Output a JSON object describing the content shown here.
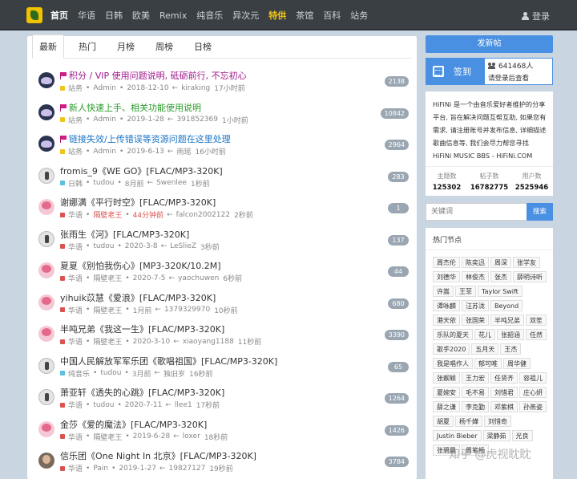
{
  "nav": {
    "items": [
      "首页",
      "华语",
      "日韩",
      "欧美",
      "Remix",
      "纯音乐",
      "异次元",
      "特供",
      "茶馆",
      "百科",
      "站务"
    ],
    "active_index": 0,
    "highlight_index": 7,
    "login": "登录"
  },
  "tabs": [
    "最新",
    "热门",
    "月榜",
    "周榜",
    "日榜"
  ],
  "threads": [
    {
      "icon": "dark-logo-avatar",
      "flag": true,
      "title": "积分 / VIP 使用问题说明, 砥砺前行, 不忘初心",
      "title_color": "#a0178a",
      "tag_color": "#f0c419",
      "forum": "站务",
      "author": "Admin",
      "date": "2018-12-10",
      "reply_user": "kiraking",
      "reply_time": "17小时前",
      "count": "2138"
    },
    {
      "icon": "dark-logo-avatar",
      "flag": true,
      "title": "新人快速上手、相关功能使用说明",
      "title_color": "#2a9a2a",
      "tag_color": "#f0c419",
      "forum": "站务",
      "author": "Admin",
      "date": "2019-1-28",
      "reply_user": "391852369",
      "reply_time": "1小时前",
      "count": "10842"
    },
    {
      "icon": "dark-logo-avatar",
      "flag": true,
      "title": "链接失效/上传错误等资源问题在这里处理",
      "title_color": "#1a74c7",
      "tag_color": "#f0c419",
      "forum": "站务",
      "author": "Admin",
      "date": "2019-6-13",
      "reply_user": "雨瑶",
      "reply_time": "16小时前",
      "count": "2964"
    },
    {
      "icon": "gray-avatar",
      "flag": false,
      "title": "fromis_9《WE GO》[FLAC/MP3-320K]",
      "title_color": "#333",
      "tag_color": "#5bc0de",
      "forum": "日韩",
      "author": "tudou",
      "date": "8月前",
      "reply_user": "Swenlee",
      "reply_time": "1秒前",
      "count": "283"
    },
    {
      "icon": "pink-avatar",
      "flag": false,
      "title": "谢娜满《平行时空》[FLAC/MP3-320K]",
      "title_color": "#333",
      "tag_color": "#d9534f",
      "forum": "华语",
      "author": "隔壁老王",
      "author_red": true,
      "date": "44分钟前",
      "date_red": true,
      "reply_user": "falcon2002122",
      "reply_time": "2秒前",
      "count": "1"
    },
    {
      "icon": "gray-avatar",
      "flag": false,
      "title": "张雨生《河》[FLAC/MP3-320K]",
      "title_color": "#333",
      "tag_color": "#d9534f",
      "forum": "华语",
      "author": "tudou",
      "date": "2020-3-8",
      "reply_user": "LeSlieZ",
      "reply_time": "3秒前",
      "count": "137"
    },
    {
      "icon": "pink-avatar",
      "flag": false,
      "title": "夏夏《别怕我伤心》[MP3-320K/10.2M]",
      "title_color": "#333",
      "tag_color": "#d9534f",
      "forum": "华语",
      "author": "隔壁老王",
      "date": "2020-7-5",
      "reply_user": "yaochuwen",
      "reply_time": "6秒前",
      "count": "44"
    },
    {
      "icon": "pink-avatar",
      "flag": false,
      "title": "yihuik苡慧《爱浪》[FLAC/MP3-320K]",
      "title_color": "#333",
      "tag_color": "#d9534f",
      "forum": "华语",
      "author": "隔壁老王",
      "date": "1月前",
      "reply_user": "1379329970",
      "reply_time": "10秒前",
      "count": "680"
    },
    {
      "icon": "pink-avatar",
      "flag": false,
      "title": "半吨兄弟《我这一生》[FLAC/MP3-320K]",
      "title_color": "#333",
      "tag_color": "#d9534f",
      "forum": "华语",
      "author": "隔壁老王",
      "date": "2020-3-10",
      "reply_user": "xiaoyang1188",
      "reply_time": "11秒前",
      "count": "3390"
    },
    {
      "icon": "gray-avatar",
      "flag": false,
      "title": "中国人民解放军军乐团《歌唱祖国》[FLAC/MP3-320K]",
      "title_color": "#333",
      "tag_color": "#5bc0de",
      "forum": "纯音乐",
      "author": "tudou",
      "date": "3月前",
      "reply_user": "独旧岁",
      "reply_time": "16秒前",
      "count": "65"
    },
    {
      "icon": "gray-avatar",
      "flag": false,
      "title": "萧亚轩《透失的心跳》[FLAC/MP3-320K]",
      "title_color": "#333",
      "tag_color": "#d9534f",
      "forum": "华语",
      "author": "tudou",
      "date": "2020-7-11",
      "reply_user": "llee1",
      "reply_time": "17秒前",
      "count": "1264"
    },
    {
      "icon": "pink-avatar",
      "flag": false,
      "title": "金莎《爱的魔法》[FLAC/MP3-320K]",
      "title_color": "#333",
      "tag_color": "#d9534f",
      "forum": "华语",
      "author": "隔壁老王",
      "date": "2019-6-28",
      "reply_user": "loxer",
      "reply_time": "18秒前",
      "count": "1426"
    },
    {
      "icon": "photo-avatar",
      "flag": false,
      "title": "信乐团《One Night In 北京》[FLAC/MP3-320K]",
      "title_color": "#333",
      "tag_color": "#d9534f",
      "forum": "华语",
      "author": "Pain",
      "date": "2019-1-27",
      "reply_user": "19827127",
      "reply_time": "19秒前",
      "count": "3784"
    }
  ],
  "sidebar": {
    "post_button": "发新帖",
    "signin_label": "签到",
    "signin_count": "641468人",
    "signin_hint": "请登录后查看",
    "intro": "HiFiNi 是一个由音乐爱好者维护的分享平台, 旨在解决问题互帮互助, 如果您有需求, 请注册账号并发布信息, 详细描述歌曲信息等, 我们会尽力帮您寻找",
    "intro_en": "HiFiNi MUSIC BBS - HiFiNi.COM",
    "stats": [
      {
        "label": "主题数",
        "value": "125302"
      },
      {
        "label": "帖子数",
        "value": "16782775"
      },
      {
        "label": "用户数",
        "value": "2525946"
      }
    ],
    "search_placeholder": "关键词",
    "search_button": "搜索",
    "hot_title": "热门节点",
    "hot_tags": [
      "周杰伦",
      "陈奕迅",
      "周深",
      "张学友",
      "刘德华",
      "林俊杰",
      "张杰",
      "薛明诗听",
      "许嵩",
      "王菲",
      "Taylor Swift",
      "谭咏麟",
      "汪苏泷",
      "Beyond",
      "港天依",
      "张国荣",
      "半吨兄弟",
      "双笙",
      "乐队的夏天",
      "花儿",
      "张韶涵",
      "任然",
      "歌手2020",
      "五月天",
      "王杰",
      "我是唱作人",
      "郁可唯",
      "周华健",
      "张靓颖",
      "王力宏",
      "任贤齐",
      "容祖儿",
      "夏婉安",
      "毛不易",
      "刘惜君",
      "庄心妍",
      "薛之谦",
      "李克勤",
      "邓紫棋",
      "孙燕姿",
      "胡夏",
      "杨千嬅",
      "刘惜奇",
      "Justin Bieber",
      "梁静茹",
      "光良",
      "张碧晨",
      "周笔畅"
    ]
  },
  "watermark": "知乎 @虎视眈眈"
}
